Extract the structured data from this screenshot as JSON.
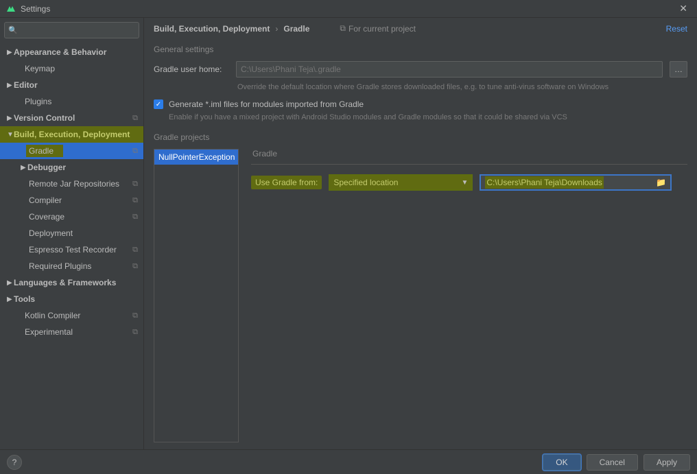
{
  "window": {
    "title": "Settings"
  },
  "search": {
    "placeholder": ""
  },
  "tree": {
    "appearance": "Appearance & Behavior",
    "keymap": "Keymap",
    "editor": "Editor",
    "plugins": "Plugins",
    "vcs": "Version Control",
    "bed": "Build, Execution, Deployment",
    "gradle": "Gradle",
    "debugger": "Debugger",
    "remotejar": "Remote Jar Repositories",
    "compiler": "Compiler",
    "coverage": "Coverage",
    "deployment": "Deployment",
    "espresso": "Espresso Test Recorder",
    "reqplugins": "Required Plugins",
    "langs": "Languages & Frameworks",
    "tools": "Tools",
    "kotlin": "Kotlin Compiler",
    "experimental": "Experimental"
  },
  "crumbs": {
    "parent": "Build, Execution, Deployment",
    "current": "Gradle",
    "scope": "For current project",
    "reset": "Reset"
  },
  "general": {
    "title": "General settings",
    "userhome_label": "Gradle user home:",
    "userhome_value": "C:\\Users\\Phani Teja\\.gradle",
    "userhome_hint": "Override the default location where Gradle stores downloaded files, e.g. to tune anti-virus software on Windows",
    "geniml_label": "Generate *.iml files for modules imported from Gradle",
    "geniml_hint": "Enable if you have a mixed project with Android Studio modules and Gradle modules so that it could be shared via VCS"
  },
  "projects": {
    "title": "Gradle projects",
    "item": "NullPointerException",
    "detail_title": "Gradle",
    "use_from_label": "Use Gradle from:",
    "use_from_value": "Specified location",
    "path": "C:\\Users\\Phani Teja\\Downloads"
  },
  "footer": {
    "ok": "OK",
    "cancel": "Cancel",
    "apply": "Apply"
  }
}
